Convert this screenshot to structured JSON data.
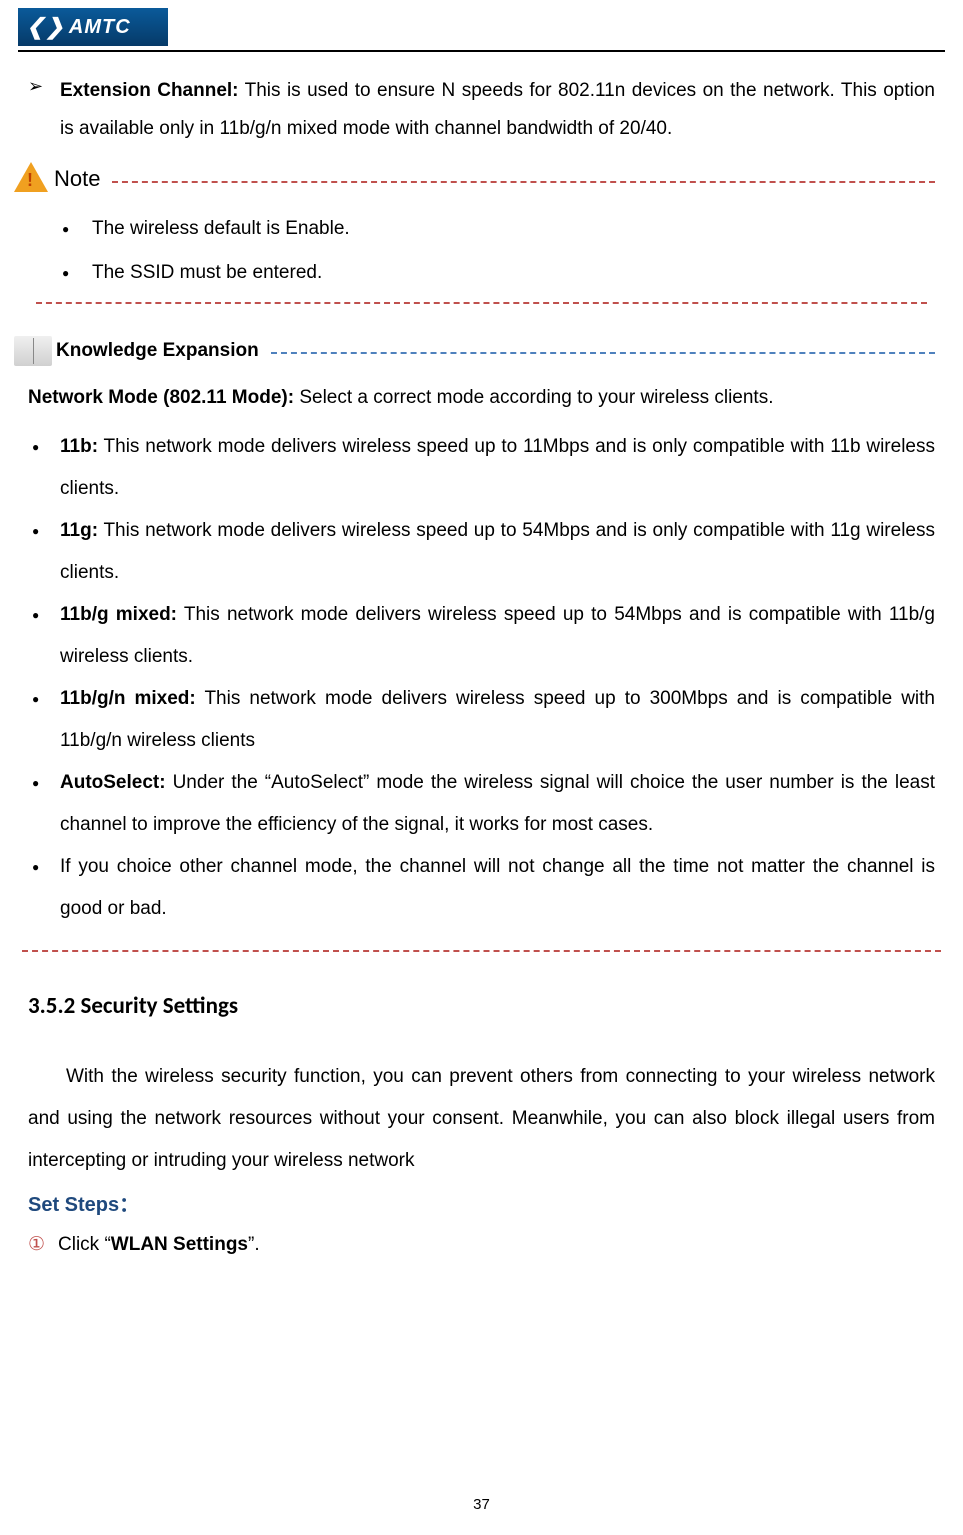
{
  "logo": {
    "symbol": "❮❯",
    "text": "AMTC"
  },
  "extension_channel": {
    "label": "Extension Channel:",
    "desc": " This is used to ensure N speeds for 802.11n devices on the network. This option is available only in 11b/g/n mixed mode with channel bandwidth of 20/40."
  },
  "note": {
    "label": "Note",
    "items": [
      "The wireless default is Enable.",
      "The SSID must be entered."
    ]
  },
  "knowledge": {
    "label": "Knowledge Expansion",
    "intro_label": "Network Mode (802.11 Mode):",
    "intro_desc": " Select a correct mode according to your wireless clients.",
    "modes": [
      {
        "label": "11b:",
        "desc": " This network mode delivers wireless speed up to 11Mbps and is only compatible with 11b wireless clients."
      },
      {
        "label": "11g:",
        "desc": " This network mode delivers wireless speed up to 54Mbps and is only compatible with 11g wireless clients."
      },
      {
        "label": "11b/g mixed:",
        "desc": " This network mode delivers wireless speed up to 54Mbps and is compatible with 11b/g wireless clients."
      },
      {
        "label": "11b/g/n mixed:",
        "desc": " This network mode delivers wireless speed up to 300Mbps and is compatible with 11b/g/n wireless clients"
      },
      {
        "label": "AutoSelect:",
        "desc": " Under the “AutoSelect” mode the wireless signal will choice the user number is the least channel to improve the efficiency of the signal, it works for most cases."
      },
      {
        "label": "",
        "desc": "If you choice other channel mode, the channel will not change all the time not matter the channel is good or bad."
      }
    ]
  },
  "security": {
    "heading": "3.5.2 Security Settings",
    "paragraph": "With the wireless security function, you can prevent others from connecting to your wireless network and using the network resources without your consent. Meanwhile, you can also block illegal users from intercepting or intruding your wireless network",
    "set_steps_label": "Set Steps：",
    "step1_num": "①",
    "step1_prefix": "Click “",
    "step1_bold": "WLAN Settings",
    "step1_suffix": "”."
  },
  "page_number": "37"
}
